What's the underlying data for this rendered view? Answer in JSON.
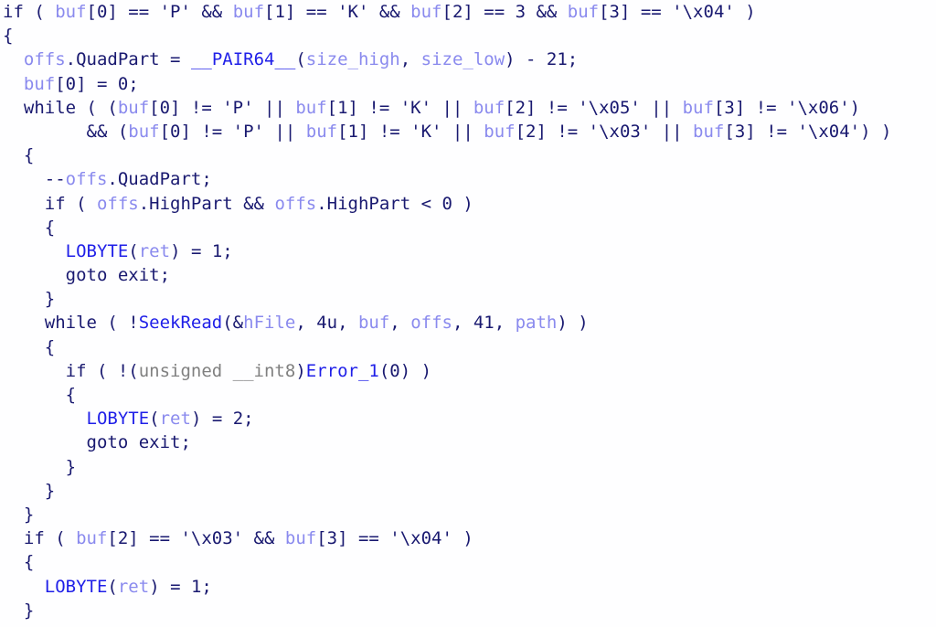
{
  "view": {
    "kind": "decompiler-pseudocode",
    "background_color": "#fefeff",
    "font_size_px": 19,
    "line_height_px": 26.2,
    "line_count": 26
  },
  "colors": {
    "default_text": "#191970",
    "variable": "#8a8aee",
    "function": "#1f1fe8",
    "type_keyword": "#808080",
    "background": "#fefeff"
  },
  "code": {
    "lines": [
      {
        "index": 0,
        "tokens": [
          {
            "text": "if ( ",
            "cls": "t-def"
          },
          {
            "text": "buf",
            "cls": "t-var"
          },
          {
            "text": "[0] == 'P' && ",
            "cls": "t-def"
          },
          {
            "text": "buf",
            "cls": "t-var"
          },
          {
            "text": "[1] == 'K' && ",
            "cls": "t-def"
          },
          {
            "text": "buf",
            "cls": "t-var"
          },
          {
            "text": "[2] == 3 && ",
            "cls": "t-def"
          },
          {
            "text": "buf",
            "cls": "t-var"
          },
          {
            "text": "[3] == '\\x04' )",
            "cls": "t-def"
          }
        ]
      },
      {
        "index": 1,
        "tokens": [
          {
            "text": "{",
            "cls": "t-def"
          }
        ]
      },
      {
        "index": 2,
        "tokens": [
          {
            "text": "  ",
            "cls": "t-def"
          },
          {
            "text": "offs",
            "cls": "t-var"
          },
          {
            "text": ".QuadPart = ",
            "cls": "t-def"
          },
          {
            "text": "__PAIR64__",
            "cls": "t-fn"
          },
          {
            "text": "(",
            "cls": "t-def"
          },
          {
            "text": "size_high",
            "cls": "t-var"
          },
          {
            "text": ", ",
            "cls": "t-def"
          },
          {
            "text": "size_low",
            "cls": "t-var"
          },
          {
            "text": ") - 21;",
            "cls": "t-def"
          }
        ]
      },
      {
        "index": 3,
        "tokens": [
          {
            "text": "  ",
            "cls": "t-def"
          },
          {
            "text": "buf",
            "cls": "t-var"
          },
          {
            "text": "[0] = 0;",
            "cls": "t-def"
          }
        ]
      },
      {
        "index": 4,
        "tokens": [
          {
            "text": "  while ( (",
            "cls": "t-def"
          },
          {
            "text": "buf",
            "cls": "t-var"
          },
          {
            "text": "[0] != 'P' || ",
            "cls": "t-def"
          },
          {
            "text": "buf",
            "cls": "t-var"
          },
          {
            "text": "[1] != 'K' || ",
            "cls": "t-def"
          },
          {
            "text": "buf",
            "cls": "t-var"
          },
          {
            "text": "[2] != '\\x05' || ",
            "cls": "t-def"
          },
          {
            "text": "buf",
            "cls": "t-var"
          },
          {
            "text": "[3] != '\\x06')",
            "cls": "t-def"
          }
        ]
      },
      {
        "index": 5,
        "tokens": [
          {
            "text": "        && (",
            "cls": "t-def"
          },
          {
            "text": "buf",
            "cls": "t-var"
          },
          {
            "text": "[0] != 'P' || ",
            "cls": "t-def"
          },
          {
            "text": "buf",
            "cls": "t-var"
          },
          {
            "text": "[1] != 'K' || ",
            "cls": "t-def"
          },
          {
            "text": "buf",
            "cls": "t-var"
          },
          {
            "text": "[2] != '\\x03' || ",
            "cls": "t-def"
          },
          {
            "text": "buf",
            "cls": "t-var"
          },
          {
            "text": "[3] != '\\x04') )",
            "cls": "t-def"
          }
        ]
      },
      {
        "index": 6,
        "tokens": [
          {
            "text": "  {",
            "cls": "t-def"
          }
        ]
      },
      {
        "index": 7,
        "tokens": [
          {
            "text": "    --",
            "cls": "t-def"
          },
          {
            "text": "offs",
            "cls": "t-var"
          },
          {
            "text": ".QuadPart;",
            "cls": "t-def"
          }
        ]
      },
      {
        "index": 8,
        "tokens": [
          {
            "text": "    if ( ",
            "cls": "t-def"
          },
          {
            "text": "offs",
            "cls": "t-var"
          },
          {
            "text": ".HighPart && ",
            "cls": "t-def"
          },
          {
            "text": "offs",
            "cls": "t-var"
          },
          {
            "text": ".HighPart < 0 )",
            "cls": "t-def"
          }
        ]
      },
      {
        "index": 9,
        "tokens": [
          {
            "text": "    {",
            "cls": "t-def"
          }
        ]
      },
      {
        "index": 10,
        "tokens": [
          {
            "text": "      ",
            "cls": "t-def"
          },
          {
            "text": "LOBYTE",
            "cls": "t-fn"
          },
          {
            "text": "(",
            "cls": "t-def"
          },
          {
            "text": "ret",
            "cls": "t-var"
          },
          {
            "text": ") = 1;",
            "cls": "t-def"
          }
        ]
      },
      {
        "index": 11,
        "tokens": [
          {
            "text": "      goto exit;",
            "cls": "t-def"
          }
        ]
      },
      {
        "index": 12,
        "tokens": [
          {
            "text": "    }",
            "cls": "t-def"
          }
        ]
      },
      {
        "index": 13,
        "tokens": [
          {
            "text": "    while ( !",
            "cls": "t-def"
          },
          {
            "text": "SeekRead",
            "cls": "t-fn"
          },
          {
            "text": "(&",
            "cls": "t-def"
          },
          {
            "text": "hFile",
            "cls": "t-var"
          },
          {
            "text": ", 4u, ",
            "cls": "t-def"
          },
          {
            "text": "buf",
            "cls": "t-var"
          },
          {
            "text": ", ",
            "cls": "t-def"
          },
          {
            "text": "offs",
            "cls": "t-var"
          },
          {
            "text": ", 41, ",
            "cls": "t-def"
          },
          {
            "text": "path",
            "cls": "t-var"
          },
          {
            "text": ") )",
            "cls": "t-def"
          }
        ]
      },
      {
        "index": 14,
        "tokens": [
          {
            "text": "    {",
            "cls": "t-def"
          }
        ]
      },
      {
        "index": 15,
        "tokens": [
          {
            "text": "      if ( !(",
            "cls": "t-def"
          },
          {
            "text": "unsigned __int8",
            "cls": "t-type"
          },
          {
            "text": ")",
            "cls": "t-def"
          },
          {
            "text": "Error_1",
            "cls": "t-fn"
          },
          {
            "text": "(0) )",
            "cls": "t-def"
          }
        ]
      },
      {
        "index": 16,
        "tokens": [
          {
            "text": "      {",
            "cls": "t-def"
          }
        ]
      },
      {
        "index": 17,
        "tokens": [
          {
            "text": "        ",
            "cls": "t-def"
          },
          {
            "text": "LOBYTE",
            "cls": "t-fn"
          },
          {
            "text": "(",
            "cls": "t-def"
          },
          {
            "text": "ret",
            "cls": "t-var"
          },
          {
            "text": ") = 2;",
            "cls": "t-def"
          }
        ]
      },
      {
        "index": 18,
        "tokens": [
          {
            "text": "        goto exit;",
            "cls": "t-def"
          }
        ]
      },
      {
        "index": 19,
        "tokens": [
          {
            "text": "      }",
            "cls": "t-def"
          }
        ]
      },
      {
        "index": 20,
        "tokens": [
          {
            "text": "    }",
            "cls": "t-def"
          }
        ]
      },
      {
        "index": 21,
        "tokens": [
          {
            "text": "  }",
            "cls": "t-def"
          }
        ]
      },
      {
        "index": 22,
        "tokens": [
          {
            "text": "  if ( ",
            "cls": "t-def"
          },
          {
            "text": "buf",
            "cls": "t-var"
          },
          {
            "text": "[2] == '\\x03' && ",
            "cls": "t-def"
          },
          {
            "text": "buf",
            "cls": "t-var"
          },
          {
            "text": "[3] == '\\x04' )",
            "cls": "t-def"
          }
        ]
      },
      {
        "index": 23,
        "tokens": [
          {
            "text": "  {",
            "cls": "t-def"
          }
        ]
      },
      {
        "index": 24,
        "tokens": [
          {
            "text": "    ",
            "cls": "t-def"
          },
          {
            "text": "LOBYTE",
            "cls": "t-fn"
          },
          {
            "text": "(",
            "cls": "t-def"
          },
          {
            "text": "ret",
            "cls": "t-var"
          },
          {
            "text": ") = 1;",
            "cls": "t-def"
          }
        ]
      },
      {
        "index": 25,
        "tokens": [
          {
            "text": "  }",
            "cls": "t-def"
          }
        ]
      }
    ]
  }
}
